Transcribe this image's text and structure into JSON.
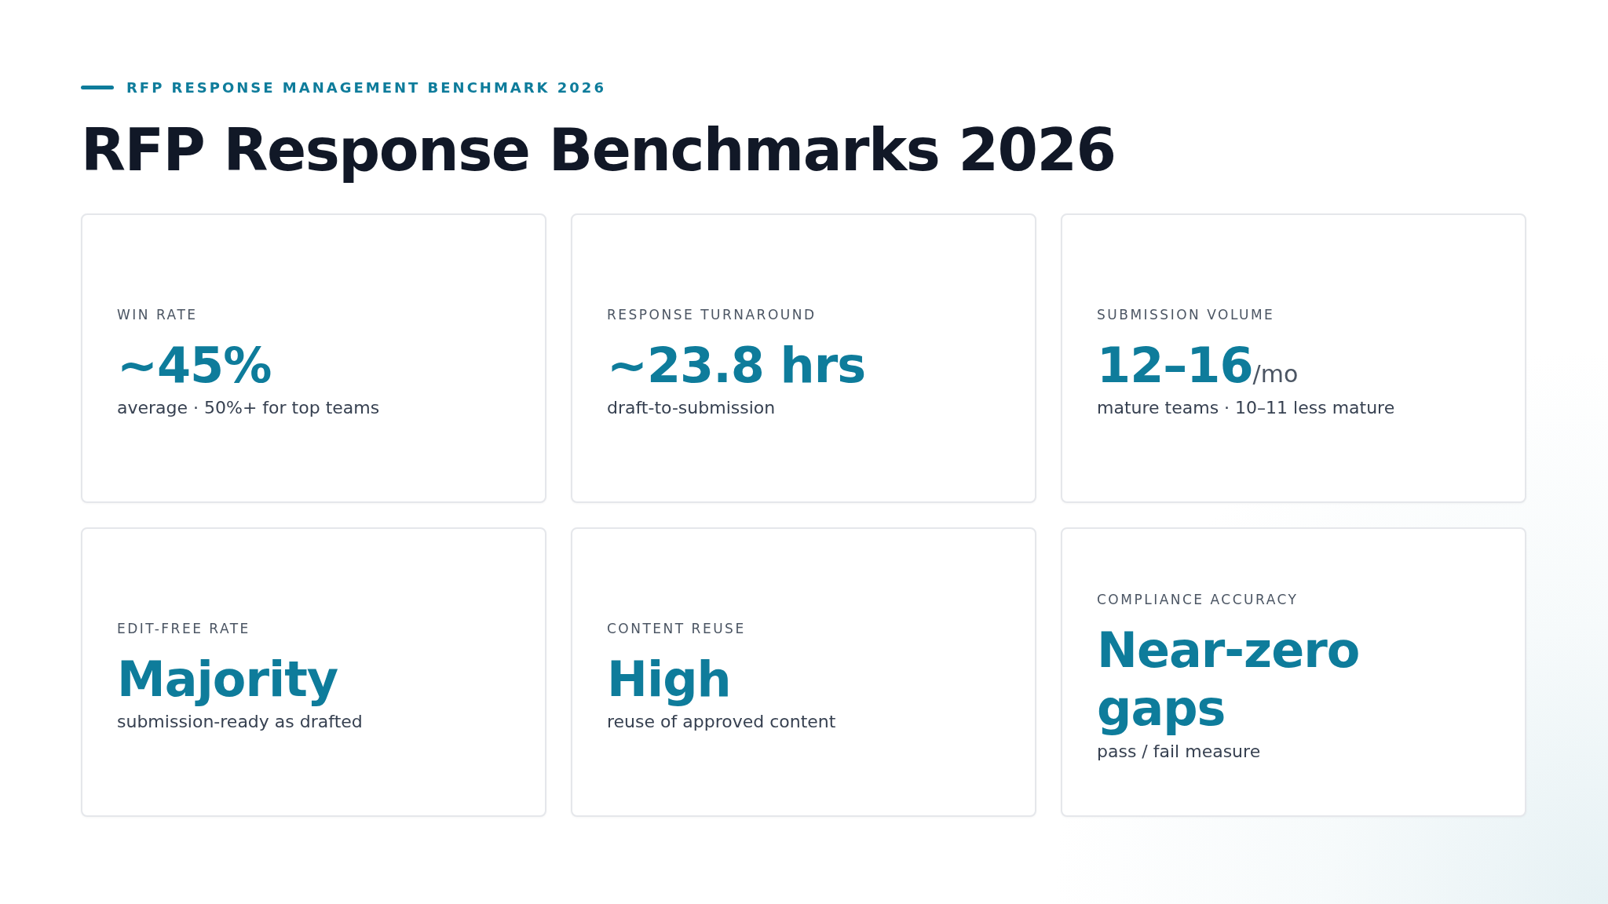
{
  "eyebrow": "RFP RESPONSE MANAGEMENT BENCHMARK 2026",
  "title": "RFP Response Benchmarks 2026",
  "cards": [
    {
      "label": "WIN RATE",
      "value": "~45%",
      "note": "average · 50%+ for top teams"
    },
    {
      "label": "RESPONSE TURNAROUND",
      "value": "~23.8 hrs",
      "note": "draft-to-submission"
    },
    {
      "label": "SUBMISSION VOLUME",
      "value": "12–16",
      "unit": "/mo",
      "note": "mature teams · 10–11 less mature"
    },
    {
      "label": "EDIT-FREE RATE",
      "value": "Majority",
      "note": "submission-ready as drafted"
    },
    {
      "label": "CONTENT REUSE",
      "value": "High",
      "note": "reuse of approved content"
    },
    {
      "label": "COMPLIANCE ACCURACY",
      "value": "Near-zero gaps",
      "note": "pass / fail measure"
    }
  ]
}
